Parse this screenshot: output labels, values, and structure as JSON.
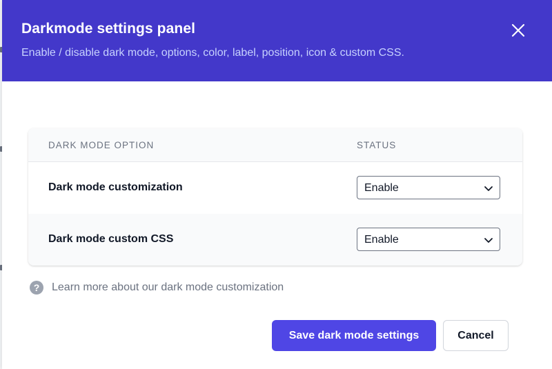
{
  "header": {
    "title": "Darkmode settings panel",
    "subtitle": "Enable / disable dark mode, options, color, label, position, icon & custom CSS."
  },
  "table": {
    "columns": [
      "DARK MODE OPTION",
      "STATUS"
    ],
    "rows": [
      {
        "label": "Dark mode customization",
        "status": "Enable"
      },
      {
        "label": "Dark mode custom CSS",
        "status": "Enable"
      }
    ]
  },
  "help": {
    "icon": "?",
    "text": "Learn more about our dark mode customization"
  },
  "actions": {
    "save_label": "Save dark mode settings",
    "cancel_label": "Cancel"
  },
  "colors": {
    "header_bg": "#4338ca",
    "primary": "#4f46e5",
    "subtitle": "#c7d2fe"
  },
  "icons": {
    "close": "close-icon",
    "chevron": "chevron-down-icon",
    "help": "question-circle-icon"
  }
}
